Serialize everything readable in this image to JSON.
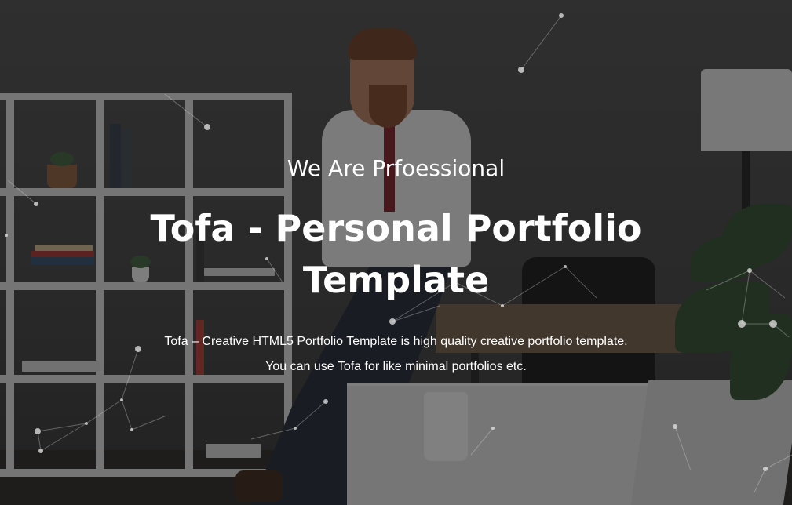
{
  "hero": {
    "subtitle": "We Are Prfoessional",
    "title": "Tofa - Personal Portfolio Template",
    "description_line1": "Tofa – Creative HTML5 Portfolio Template is high quality creative portfolio template.",
    "description_line2": "You can use Tofa for like minimal portfolios etc."
  },
  "colors": {
    "text": "#ffffff",
    "overlay": "rgba(20,20,20,0.5)",
    "particle": "#dddddd"
  }
}
